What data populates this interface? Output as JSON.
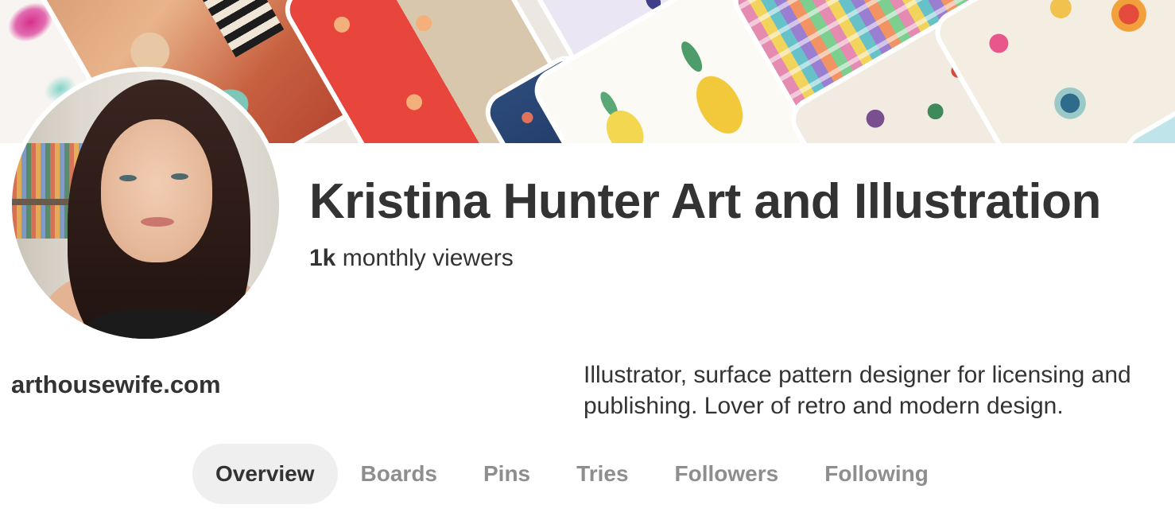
{
  "profile": {
    "name": "Kristina Hunter Art and Illustration",
    "viewers_count": "1k",
    "viewers_label": "monthly viewers",
    "website": "arthousewife.com",
    "bio": "Illustrator, surface pattern designer for licensing and publishing. Lover of retro and modern design."
  },
  "tabs": [
    {
      "label": "Overview",
      "active": true
    },
    {
      "label": "Boards",
      "active": false
    },
    {
      "label": "Pins",
      "active": false
    },
    {
      "label": "Tries",
      "active": false
    },
    {
      "label": "Followers",
      "active": false
    },
    {
      "label": "Following",
      "active": false
    }
  ],
  "colors": {
    "text_primary": "#333333",
    "text_muted": "#8e8e8e",
    "active_tab_bg": "#efefef",
    "background": "#ffffff"
  }
}
